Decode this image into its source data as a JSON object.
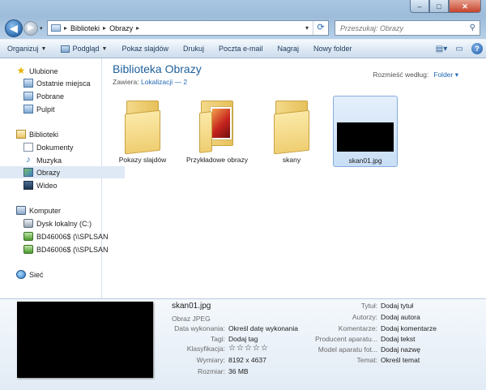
{
  "window": {
    "controls": {
      "minimize": "–",
      "maximize": "□",
      "close": "✕"
    }
  },
  "nav": {
    "back_glyph": "◀",
    "forward_glyph": "▶",
    "breadcrumb": [
      "Biblioteki",
      "Obrazy"
    ],
    "search_placeholder": "Przeszukaj: Obrazy"
  },
  "toolbar": {
    "items": [
      "Organizuj",
      "Podgląd",
      "Pokaz slajdów",
      "Drukuj",
      "Poczta e-mail",
      "Nagraj",
      "Nowy folder"
    ]
  },
  "sidebar": {
    "favorites": {
      "label": "Ulubione",
      "items": [
        "Ostatnie miejsca",
        "Pobrane",
        "Pulpit"
      ]
    },
    "libraries": {
      "label": "Biblioteki",
      "items": [
        "Dokumenty",
        "Muzyka",
        "Obrazy",
        "Wideo"
      ],
      "selected": "Obrazy"
    },
    "computer": {
      "label": "Komputer",
      "items": [
        "Dysk lokalny (C:)",
        "BD46006$ (\\\\SPLSAN",
        "BD46006$ (\\\\SPLSAN"
      ]
    },
    "network": {
      "label": "Sieć"
    }
  },
  "content": {
    "title": "Biblioteka Obrazy",
    "includes_label": "Zawiera:",
    "includes_link": "Lokalizacji — 2",
    "arrange_label": "Rozmieść według:",
    "arrange_value": "Folder",
    "tiles": [
      {
        "label": "Pokazy slajdów",
        "kind": "folder"
      },
      {
        "label": "Przykładowe obrazy",
        "kind": "folder-photo"
      },
      {
        "label": "skany",
        "kind": "folder"
      },
      {
        "label": "skan01.jpg",
        "kind": "image",
        "selected": true
      }
    ]
  },
  "details": {
    "file_name": "skan01.jpg",
    "file_type": "Obraz JPEG",
    "left": [
      {
        "key": "Data wykonania:",
        "value": "Określ datę wykonania"
      },
      {
        "key": "Tagi:",
        "value": "Dodaj tag"
      },
      {
        "key": "Klasyfikacja:",
        "value": "☆☆☆☆☆",
        "rating": 0
      },
      {
        "key": "Wymiary:",
        "value": "8192 x 4637"
      },
      {
        "key": "Rozmiar:",
        "value": "36 MB"
      }
    ],
    "right": [
      {
        "key": "Tytuł:",
        "value": "Dodaj tytuł"
      },
      {
        "key": "Autorzy:",
        "value": "Dodaj autora"
      },
      {
        "key": "Komentarze:",
        "value": "Dodaj komentarze"
      },
      {
        "key": "Producent aparatu...",
        "value": "Dodaj tekst"
      },
      {
        "key": "Model aparatu fot...",
        "value": "Dodaj nazwę"
      },
      {
        "key": "Temat:",
        "value": "Określ temat"
      }
    ]
  }
}
